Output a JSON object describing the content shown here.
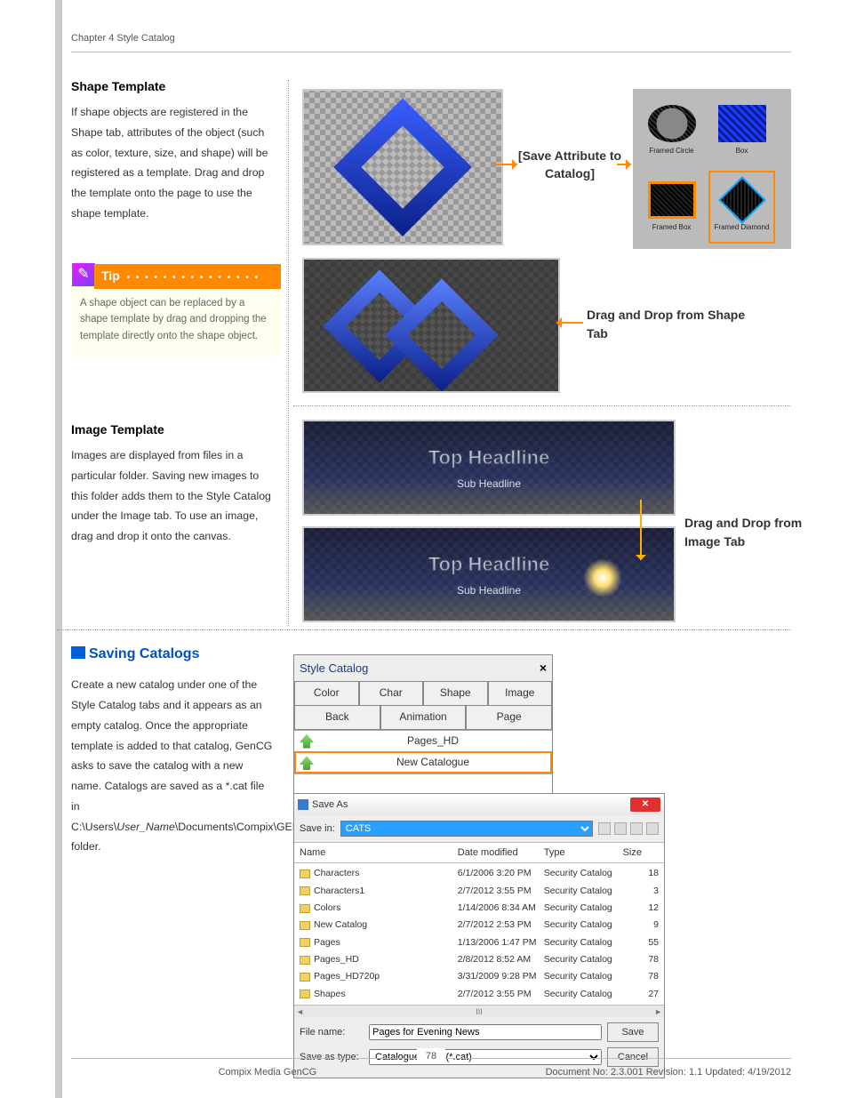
{
  "header": {
    "chapter": "Chapter 4 Style Catalog"
  },
  "shape_template": {
    "heading": "Shape Template",
    "body": "If shape objects are registered in the Shape tab, attributes of the object (such as color, texture, size, and shape) will be registered as a template. Drag and drop the template onto the page to use the shape template."
  },
  "tip": {
    "label": "Tip",
    "body": "A shape object can be replaced by a shape template by drag and dropping the template directly onto the shape object."
  },
  "image_template": {
    "heading": "Image Template",
    "body": "Images are displayed from files in a particular folder. Saving new images to this folder adds them to the Style Catalog under the Image tab. To use an image, drag and drop it onto the canvas."
  },
  "saving": {
    "heading": "Saving Catalogs",
    "body_prefix": "Create a new catalog under one of the Style Catalog tabs and it appears as an empty catalog. Once the appropriate template is added to that catalog, GenCG asks to save the catalog with a new name. Catalogs are saved as a *.cat file in C:\\Users\\",
    "body_italic": "User_Name",
    "body_suffix": "\\Documents\\Compix\\GENCG\\CATS folder."
  },
  "callouts": {
    "save_attr": "[Save Attribute to Catalog]",
    "dd_shape": "Drag and Drop from Shape Tab",
    "dd_image": "Drag and Drop from Image Tab"
  },
  "shape_palette": {
    "items": [
      {
        "label": "Framed Circle"
      },
      {
        "label": "Box"
      },
      {
        "label": "Framed Box"
      },
      {
        "label": "Framed Diamond"
      }
    ]
  },
  "headline": {
    "top": "Top Headline",
    "sub": "Sub Headline"
  },
  "style_catalog_panel": {
    "title": "Style Catalog",
    "tabs_r1": [
      "Color",
      "Char",
      "Shape",
      "Image"
    ],
    "tabs_r2": [
      "Back",
      "Animation",
      "Page"
    ],
    "rows": [
      "Pages_HD",
      "New Catalogue"
    ]
  },
  "saveas": {
    "title": "Save As",
    "save_in_label": "Save in:",
    "save_in_value": "CATS",
    "cols": [
      "Name",
      "Date modified",
      "Type",
      "Size"
    ],
    "rows": [
      {
        "name": "Characters",
        "date": "6/1/2006 3:20 PM",
        "type": "Security Catalog",
        "size": "18"
      },
      {
        "name": "Characters1",
        "date": "2/7/2012 3:55 PM",
        "type": "Security Catalog",
        "size": "3"
      },
      {
        "name": "Colors",
        "date": "1/14/2006 8:34 AM",
        "type": "Security Catalog",
        "size": "12"
      },
      {
        "name": "New Catalog",
        "date": "2/7/2012 2:53 PM",
        "type": "Security Catalog",
        "size": "9"
      },
      {
        "name": "Pages",
        "date": "1/13/2006 1:47 PM",
        "type": "Security Catalog",
        "size": "55"
      },
      {
        "name": "Pages_HD",
        "date": "2/8/2012 8:52 AM",
        "type": "Security Catalog",
        "size": "78"
      },
      {
        "name": "Pages_HD720p",
        "date": "3/31/2009 9:28 PM",
        "type": "Security Catalog",
        "size": "78"
      },
      {
        "name": "Shapes",
        "date": "2/7/2012 3:55 PM",
        "type": "Security Catalog",
        "size": "27"
      }
    ],
    "file_name_label": "File name:",
    "file_name_value": "Pages for Evening News",
    "save_type_label": "Save as type:",
    "save_type_value": "Catalogue Files (*.cat)",
    "save_button": "Save",
    "cancel_button": "Cancel"
  },
  "footer": {
    "page": "78",
    "center": "Compix Media GenCG",
    "right": "Document No: 2.3.001 Revision: 1.1 Updated: 4/19/2012"
  }
}
